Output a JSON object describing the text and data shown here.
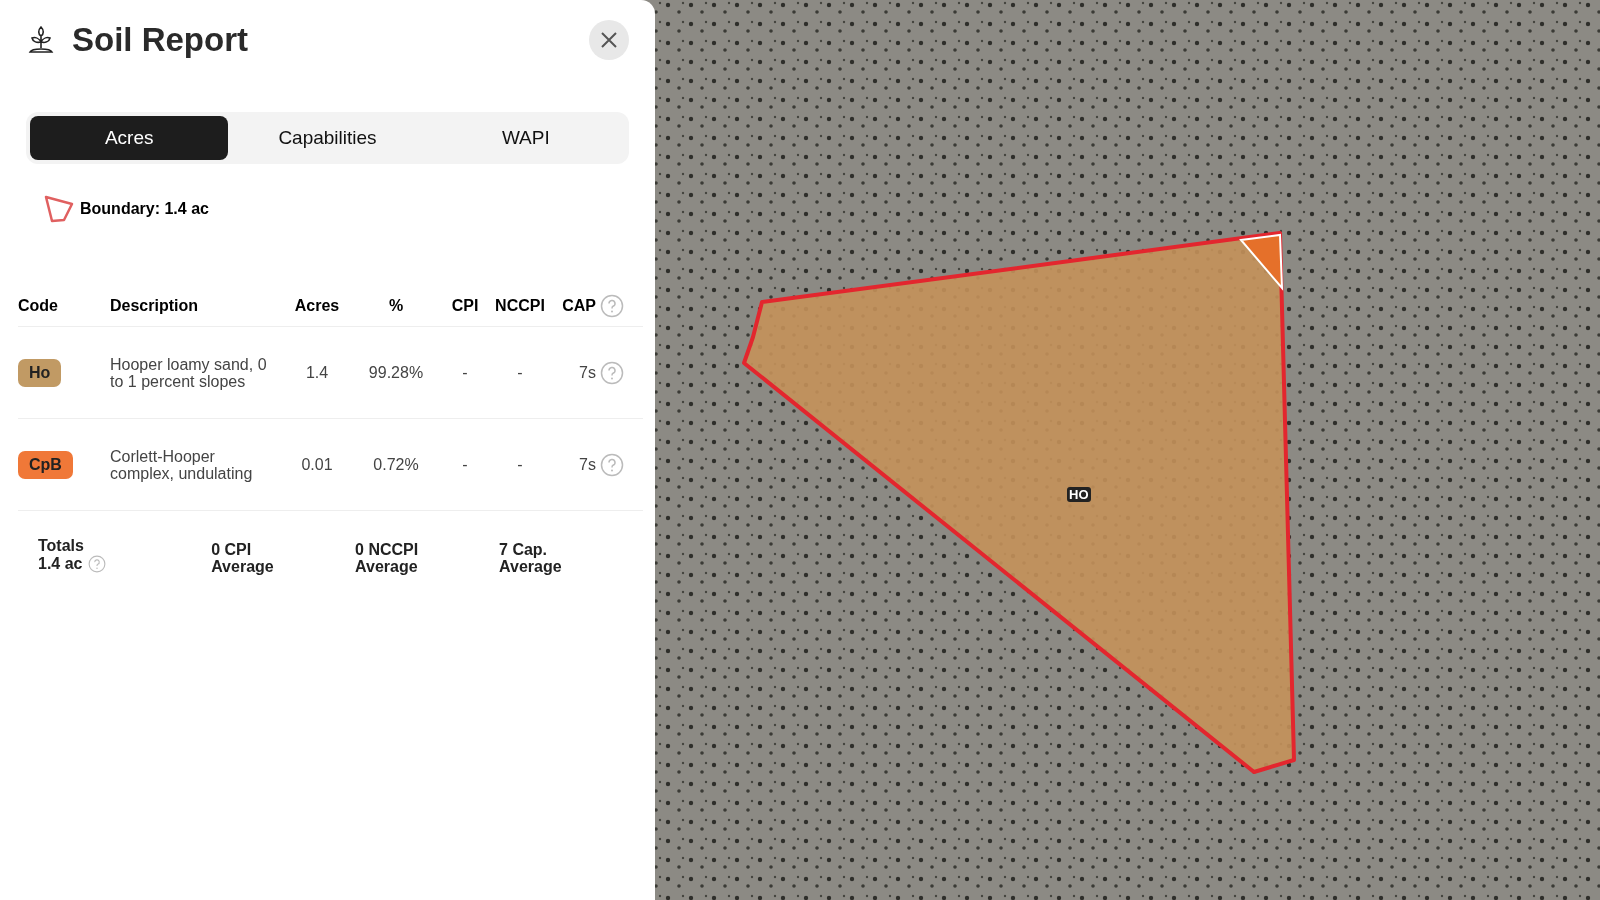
{
  "panel": {
    "title": "Soil Report"
  },
  "tabs": [
    {
      "label": "Acres",
      "selected": true
    },
    {
      "label": "Capabilities",
      "selected": false
    },
    {
      "label": "WAPI",
      "selected": false
    }
  ],
  "boundary": {
    "label": "Boundary: 1.4 ac"
  },
  "table": {
    "columns": [
      "Code",
      "Description",
      "Acres",
      "%",
      "CPI",
      "NCCPI",
      "CAP"
    ],
    "rows": [
      {
        "code": "Ho",
        "color": "#c19a64",
        "description": "Hooper loamy sand, 0 to 1 percent slopes",
        "acres": "1.4",
        "percent": "99.28%",
        "cpi": "-",
        "nccpi": "-",
        "cap": "7s"
      },
      {
        "code": "CpB",
        "color": "#f07838",
        "description": "Corlett-Hooper complex, undulating",
        "acres": "0.01",
        "percent": "0.72%",
        "cpi": "-",
        "nccpi": "-",
        "cap": "7s"
      }
    ]
  },
  "totals": {
    "label": "Totals",
    "acres": "1.4 ac",
    "cpi": [
      "0 CPI",
      "Average"
    ],
    "nccpi": [
      "0 NCCPI",
      "Average"
    ],
    "cap": [
      "7 Cap.",
      "Average"
    ]
  },
  "map": {
    "label": "HO"
  }
}
